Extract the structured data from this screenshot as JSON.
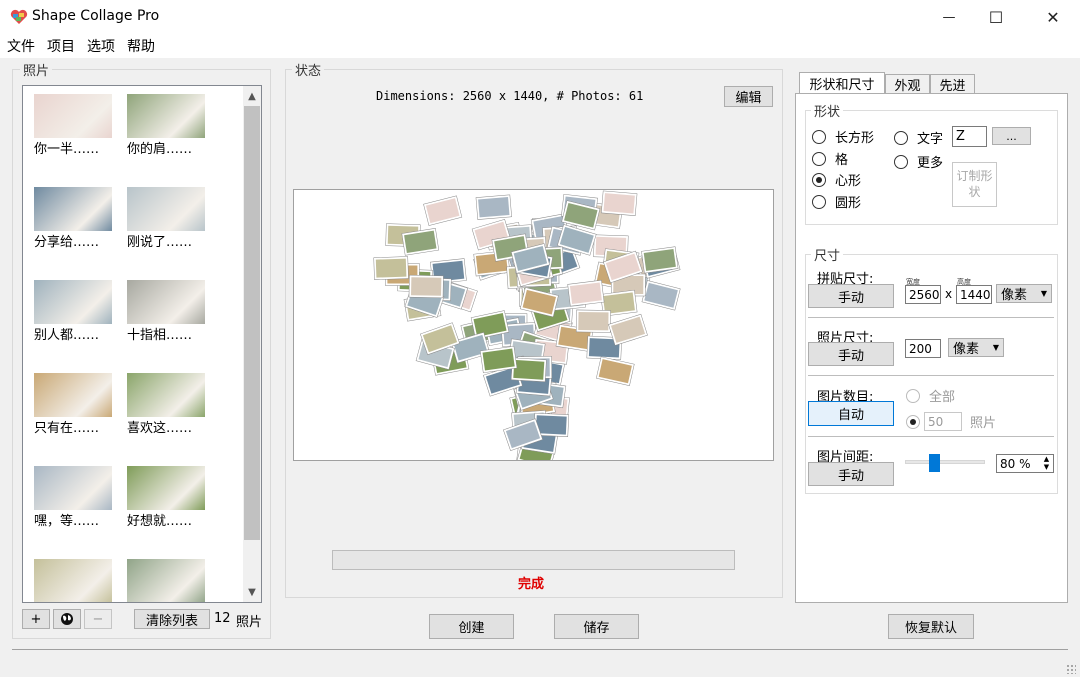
{
  "window": {
    "title": "Shape Collage Pro",
    "minimize_glyph": "—",
    "maximize_glyph": "☐",
    "close_glyph": "✕"
  },
  "menu": [
    "文件",
    "项目",
    "选项",
    "帮助"
  ],
  "photos_panel": {
    "label": "照片",
    "items": [
      {
        "caption": "你一半……",
        "color": "#e9d4cf"
      },
      {
        "caption": "你的肩……",
        "color": "#8fa47a"
      },
      {
        "caption": "分享给……",
        "color": "#6f8aa0"
      },
      {
        "caption": "刚说了……",
        "color": "#b8c4ca"
      },
      {
        "caption": "别人都……",
        "color": "#9fb2bd"
      },
      {
        "caption": "十指相……",
        "color": "#a7a8a0"
      },
      {
        "caption": "只有在……",
        "color": "#c9a875"
      },
      {
        "caption": "喜欢这……",
        "color": "#8aa56a"
      },
      {
        "caption": "嘿，等……",
        "color": "#a9b7c4"
      },
      {
        "caption": "好想就……",
        "color": "#7f9c59"
      },
      {
        "caption": "",
        "color": "#c4c09a"
      },
      {
        "caption": "",
        "color": "#90a488"
      }
    ],
    "add_label": "+",
    "globe_icon": "globe-icon",
    "remove_label": "−",
    "clear_label": "清除列表",
    "count": "12",
    "count_unit": "照片"
  },
  "status_panel": {
    "label": "状态",
    "dimensions_text": "Dimensions: 2560 x 1440, # Photos: 61",
    "edit_label": "编辑",
    "progress": 0,
    "done_text": "完成",
    "done_color": "#e00000"
  },
  "bottom": {
    "create_label": "创建",
    "save_label": "储存",
    "reset_label": "恢复默认"
  },
  "tabs": [
    "形状和尺寸",
    "外观",
    "先进"
  ],
  "shape": {
    "label": "形状",
    "options": [
      "长方形",
      "格",
      "心形",
      "圆形"
    ],
    "selected": "心形",
    "text_label": "文字",
    "text_value": "Z",
    "more_label": "更多",
    "browse_label": "...",
    "custom_label": "订制形状"
  },
  "size": {
    "label": "尺寸",
    "collage_size_label": "拼贴尺寸:",
    "collage_mode": "手动",
    "width_caption": "宽度",
    "height_caption": "高度",
    "width": "2560",
    "x_sep": "x",
    "height": "1440",
    "unit": "像素",
    "photo_size_label": "照片尺寸:",
    "photo_mode": "手动",
    "photo_size": "200",
    "photo_unit": "像素",
    "photo_count_label": "图片数目:",
    "count_mode": "自动",
    "all_label": "全部",
    "count_value": "50",
    "count_unit": "照片",
    "spacing_label": "图片间距:",
    "spacing_mode": "手动",
    "spacing_value": "80 %",
    "spacing_level": 0.8
  }
}
